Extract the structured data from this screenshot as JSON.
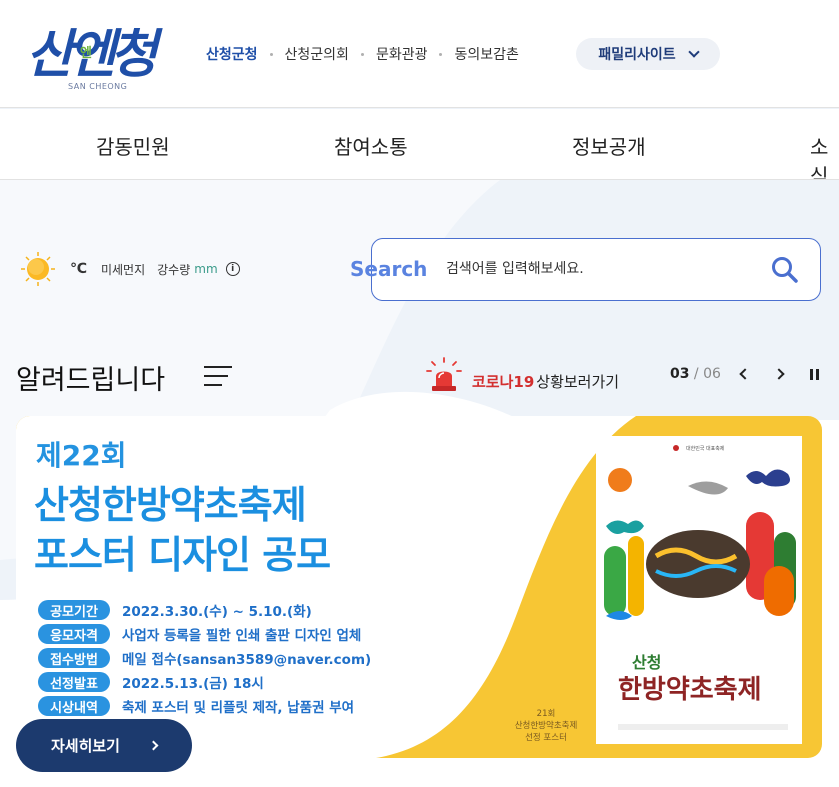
{
  "header": {
    "logo_text": "산엔청",
    "logo_mid": "엔",
    "logo_sub": "SAN CHEONG",
    "links": [
      "산청군청",
      "산청군의회",
      "문화관광",
      "동의보감촌"
    ],
    "family_site": "패밀리사이트"
  },
  "nav": {
    "items": [
      "감동민원",
      "참여소통",
      "정보공개",
      "소식"
    ]
  },
  "weather": {
    "temp_unit": "℃",
    "dust_label": "미세먼지",
    "rain_label": "강수량",
    "rain_unit": "mm",
    "info_glyph": "i"
  },
  "search": {
    "label": "Search",
    "placeholder": "검색어를 입력해보세요."
  },
  "notice": {
    "title": "알려드립니다",
    "covid_red": "코로나19",
    "covid_text": "상황보러가기",
    "page_current": "03",
    "page_sep": " / ",
    "page_total": "06"
  },
  "banner": {
    "edition": "제22회",
    "title1": "산청한방약초축제",
    "title2": "포스터 디자인 공모",
    "rows": [
      {
        "tag": "공모기간",
        "value": "2022.3.30.(수) ~ 5.10.(화)"
      },
      {
        "tag": "응모자격",
        "value": "사업자 등록을 필한 인쇄 출판 디자인 업체"
      },
      {
        "tag": "접수방법",
        "value": "메일 접수(sansan3589@naver.com)"
      },
      {
        "tag": "선정발표",
        "value": "2022.5.13.(금) 18시"
      },
      {
        "tag": "시상내역",
        "value": "축제 포스터 및 리플릿 제작, 납품권 부여"
      }
    ],
    "poster_caption": [
      "21회",
      "산청한방약초축제",
      "선정 포스터"
    ],
    "poster_top": "대한민국 대표축제",
    "poster_title1": "산청",
    "poster_title2": "한방약초축제"
  },
  "detail_button": "자세히보기",
  "colors": {
    "brand": "#1f4fa8",
    "accent_blue": "#1b8fe0",
    "banner_yellow": "#f7c634",
    "button_navy": "#1c3a6e"
  }
}
